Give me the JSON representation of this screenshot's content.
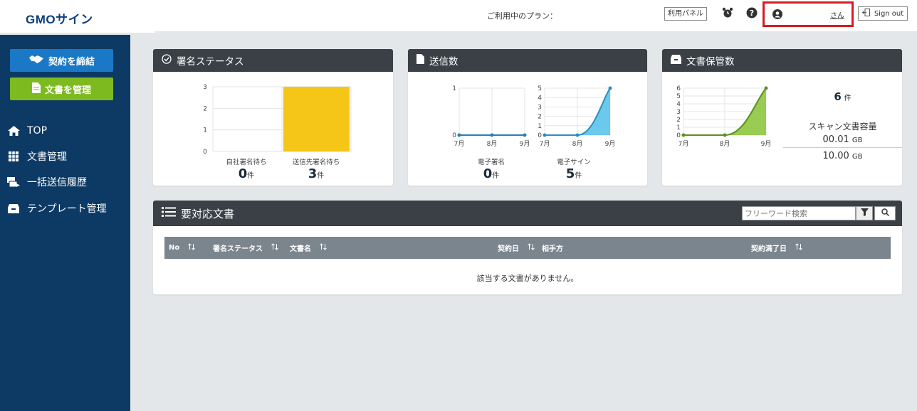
{
  "header": {
    "logo": "GMOサイン",
    "plan_label": "ご利用中のプラン：",
    "panel_button": "利用パネル",
    "user_suffix": "さん",
    "signout": "Sign out"
  },
  "sidebar": {
    "contract_button": "契約を締結",
    "manage_button": "文書を管理",
    "items": [
      {
        "label": "TOP",
        "icon": "home-icon"
      },
      {
        "label": "文書管理",
        "icon": "grid-icon"
      },
      {
        "label": "一括送信履歴",
        "icon": "batch-send-icon"
      },
      {
        "label": "テンプレート管理",
        "icon": "template-icon"
      }
    ]
  },
  "signature_status": {
    "title": "署名ステータス",
    "chart_data": {
      "type": "bar",
      "categories": [
        "自社署名待ち",
        "送信先署名待ち"
      ],
      "values": [
        0,
        3
      ],
      "ylim": [
        0,
        3
      ],
      "yticks": [
        "0",
        "1",
        "2",
        "3"
      ],
      "color": "#f5c518"
    },
    "stats": [
      {
        "label": "自社署名待ち",
        "value": "0",
        "unit": "件"
      },
      {
        "label": "送信先署名待ち",
        "value": "3",
        "unit": "件"
      }
    ]
  },
  "sent_count": {
    "title": "送信数",
    "charts": [
      {
        "type": "line",
        "categories": [
          "7月",
          "8月",
          "9月"
        ],
        "values": [
          0,
          0,
          0
        ],
        "ylim": [
          0,
          1
        ],
        "yticks": [
          "0",
          "1"
        ],
        "color": "#2a7fb0"
      },
      {
        "type": "area",
        "categories": [
          "7月",
          "8月",
          "9月"
        ],
        "values": [
          0,
          0,
          5
        ],
        "ylim": [
          0,
          5
        ],
        "yticks": [
          "0",
          "1",
          "2",
          "3",
          "4",
          "5"
        ],
        "color": "#5bc3ea"
      }
    ],
    "stats": [
      {
        "label": "電子署名",
        "value": "0",
        "unit": "件"
      },
      {
        "label": "電子サイン",
        "value": "5",
        "unit": "件"
      }
    ]
  },
  "storage": {
    "title": "文書保管数",
    "chart_data": {
      "type": "area",
      "categories": [
        "7月",
        "8月",
        "9月"
      ],
      "values": [
        0,
        0,
        6
      ],
      "ylim": [
        0,
        6
      ],
      "yticks": [
        "0",
        "1",
        "2",
        "3",
        "4",
        "5",
        "6"
      ],
      "color": "#8dc63f"
    },
    "count_value": "6",
    "count_unit": "件",
    "scan_label": "スキャン文書容量",
    "scan_used": "00.01",
    "scan_total": "10.00",
    "scan_unit": "GB"
  },
  "pending": {
    "title": "要対応文書",
    "search_placeholder": "フリーワード検索",
    "columns": [
      "No",
      "署名ステータス",
      "文書名",
      "契約日",
      "相手方",
      "契約満了日"
    ],
    "empty_message": "該当する文書がありません。"
  }
}
